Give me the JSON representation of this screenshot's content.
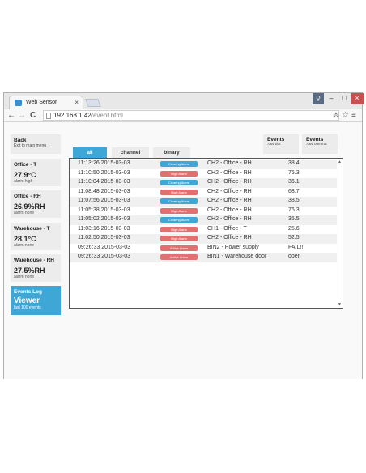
{
  "browser": {
    "tab_title": "Web Sensor",
    "tab_close": "×",
    "url_host": "192.168.1.42",
    "url_path": "/event.html",
    "icons": {
      "back": "back-arrow-icon",
      "forward": "forward-arrow-icon",
      "reload": "reload-icon",
      "page": "page-icon",
      "translate": "translate-icon",
      "star": "star-icon",
      "menu": "menu-icon"
    },
    "glyphs": {
      "back": "←",
      "forward": "→",
      "reload": "C",
      "translate": "⁂",
      "star": "☆",
      "menu": "≡",
      "user": "⚲",
      "min": "–",
      "max": "□",
      "close": "×"
    }
  },
  "sidebar": {
    "back": {
      "title": "Back",
      "subtitle": "Exit to main menu"
    },
    "sensors": [
      {
        "title": "Office - T",
        "value": "27.9°C",
        "status": "alarm high"
      },
      {
        "title": "Office - RH",
        "value": "26.9%RH",
        "status": "alarm none"
      },
      {
        "title": "Warehouse - T",
        "value": "28.1°C",
        "status": "alarm none"
      },
      {
        "title": "Warehouse - RH",
        "value": "27.5%RH",
        "status": "alarm none"
      }
    ],
    "events": {
      "title": "Events Log",
      "value": "Viewer",
      "subtitle": "last 100 events"
    }
  },
  "top_buttons": {
    "csv_dot": {
      "title": "Events",
      "subtitle": ".csv dot"
    },
    "csv_comma": {
      "title": "Events",
      "subtitle": ".csv comma"
    }
  },
  "filter_tabs": [
    "all",
    "channel",
    "binary"
  ],
  "colors": {
    "clearing": "#3fa7d6",
    "high": "#e27070",
    "active": "#e27070",
    "accent": "#3fa7d6"
  },
  "events": [
    {
      "time": "11:13:26 2015-03-03",
      "badge": "Clearing Alarm",
      "type": "clearing",
      "channel": "CH2 - Office - RH",
      "value": "38.4"
    },
    {
      "time": "11:10:50 2015-03-03",
      "badge": "High Alarm",
      "type": "high",
      "channel": "CH2 - Office - RH",
      "value": "75.3"
    },
    {
      "time": "11:10:04 2015-03-03",
      "badge": "Clearing Alarm",
      "type": "clearing",
      "channel": "CH2 - Office - RH",
      "value": "36.1"
    },
    {
      "time": "11:08:48 2015-03-03",
      "badge": "High Alarm",
      "type": "high",
      "channel": "CH2 - Office - RH",
      "value": "68.7"
    },
    {
      "time": "11:07:56 2015-03-03",
      "badge": "Clearing Alarm",
      "type": "clearing",
      "channel": "CH2 - Office - RH",
      "value": "38.5"
    },
    {
      "time": "11:05:38 2015-03-03",
      "badge": "High Alarm",
      "type": "high",
      "channel": "CH2 - Office - RH",
      "value": "76.3"
    },
    {
      "time": "11:05:02 2015-03-03",
      "badge": "Clearing Alarm",
      "type": "clearing",
      "channel": "CH2 - Office - RH",
      "value": "35.5"
    },
    {
      "time": "11:03:16 2015-03-03",
      "badge": "High Alarm",
      "type": "high",
      "channel": "CH1 - Office - T",
      "value": "25.6"
    },
    {
      "time": "11:02:50 2015-03-03",
      "badge": "High Alarm",
      "type": "high",
      "channel": "CH2 - Office - RH",
      "value": "52.5"
    },
    {
      "time": "09:26:33 2015-03-03",
      "badge": "Active Alarm",
      "type": "active",
      "channel": "BIN2 - Power supply",
      "value": "FAIL!!"
    },
    {
      "time": "09:26:33 2015-03-03",
      "badge": "Active Alarm",
      "type": "active",
      "channel": "BIN1 - Warehouse door",
      "value": "open"
    }
  ]
}
